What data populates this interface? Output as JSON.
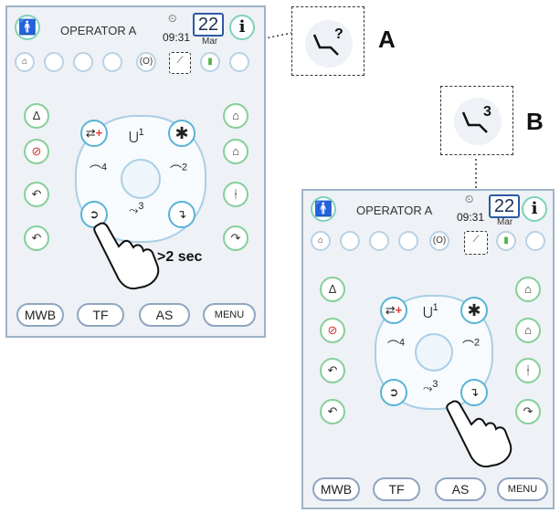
{
  "panel1": {
    "operator": "OPERATOR A",
    "time": "09:31",
    "date_day": "22",
    "date_month": "Mar",
    "bottom": [
      "MWB",
      "TF",
      "AS",
      "MENU"
    ],
    "center_numbers": [
      "1",
      "2",
      "3",
      "4"
    ],
    "hold_text": ">2 sec"
  },
  "panel2": {
    "operator": "OPERATOR A",
    "time": "09:31",
    "date_day": "22",
    "date_month": "Mar",
    "bottom": [
      "MWB",
      "TF",
      "AS",
      "MENU"
    ],
    "center_numbers": [
      "1",
      "2",
      "3",
      "4"
    ]
  },
  "callout_a": {
    "letter": "A",
    "symbol": "?"
  },
  "callout_b": {
    "letter": "B",
    "symbol": "3"
  },
  "icons": {
    "user": "user-icon",
    "info": "info-icon",
    "clock": "clock-icon",
    "bell": "bell-icon",
    "cup": "cup-icon",
    "lamp": "lamp-icon",
    "program": "chair-program-icon",
    "hand": "pointing-hand-icon"
  },
  "colors": {
    "panel_bg": "#eef1f5",
    "panel_border": "#9fb3c8",
    "accent_green": "#86cf9a",
    "accent_blue": "#59b3d6",
    "date_border": "#2b5aa3",
    "red_plus": "#e53935"
  }
}
